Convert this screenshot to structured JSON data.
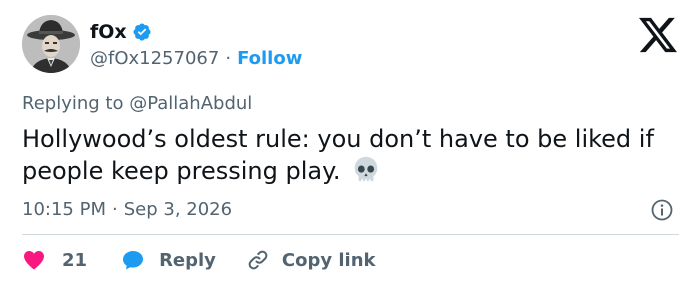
{
  "author": {
    "display_name": "fOx",
    "handle": "@fOx1257067",
    "separator": "·",
    "follow_label": "Follow"
  },
  "icons": {
    "avatar": "avatar-cowboy-hat",
    "verified": "verified-badge-icon",
    "logo": "x-logo-icon",
    "emoji": "skull-icon",
    "info": "info-icon",
    "like": "heart-icon",
    "reply": "speech-bubble-icon",
    "copy": "link-icon"
  },
  "colors": {
    "accent": "#1d9bf0",
    "text": "#0f1419",
    "muted": "#536471",
    "like": "#f91880",
    "divider": "#cfd9de"
  },
  "tweet": {
    "replying_to": "Replying to @PallahAbdul",
    "text": "Hollywood’s oldest rule: you don’t have to be liked if people keep pressing play.",
    "time": "10:15 PM",
    "separator": "·",
    "date": "Sep 3, 2026"
  },
  "actions": {
    "like_count": "21",
    "reply_label": "Reply",
    "copy_label": "Copy link"
  }
}
